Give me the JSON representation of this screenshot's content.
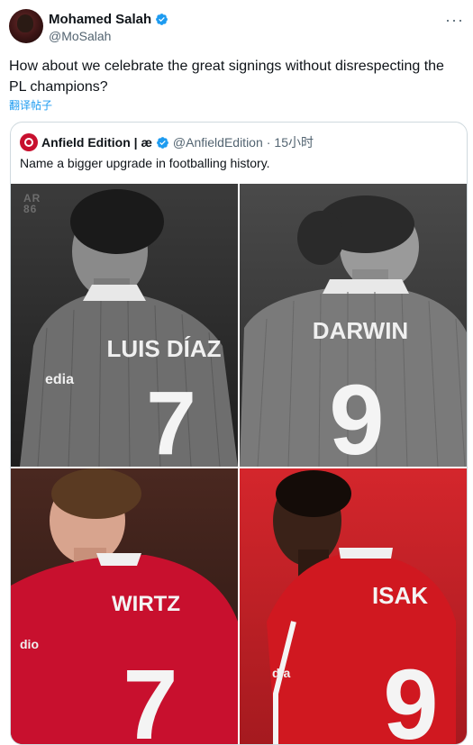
{
  "author": {
    "name": "Mohamed Salah",
    "handle": "@MoSalah",
    "more_icon": "more-icon"
  },
  "tweet": {
    "text": "How about we celebrate the great signings without disrespecting the PL champions?",
    "translate_label": "翻译帖子"
  },
  "quote": {
    "name": "Anfield Edition | æ",
    "handle": "@AnfieldEdition",
    "separator": "·",
    "time": "15小时",
    "text": "Name a bigger upgrade in footballing history.",
    "image": {
      "watermark": [
        "AR",
        "86"
      ],
      "players": [
        {
          "name": "LUIS DÍAZ",
          "number": "7",
          "sponsor": "edia"
        },
        {
          "name": "DARWIN",
          "number": "9"
        },
        {
          "name": "WIRTZ",
          "number": "7",
          "sponsor": "dio"
        },
        {
          "name": "ISAK",
          "number": "9",
          "sponsor": "dia"
        }
      ]
    }
  },
  "colors": {
    "verified": "#1d9bf0",
    "link": "#1d9bf0",
    "liverpool_red": "#c8102e"
  }
}
